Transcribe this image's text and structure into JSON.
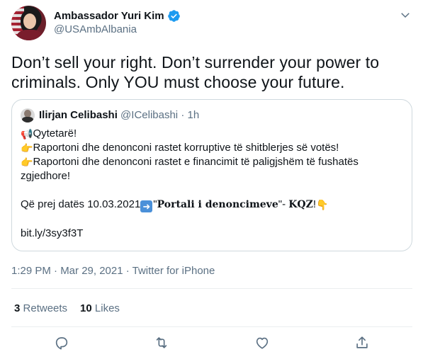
{
  "author": {
    "display_name": "Ambassador Yuri Kim",
    "handle": "@USAmbAlbania"
  },
  "tweet_text": "Don’t sell your right. Don’t surrender your power to criminals. Only YOU must choose your future.",
  "quoted_tweet": {
    "display_name": "Ilirjan Celibashi",
    "handle": "@ICelibashi",
    "separator": "·",
    "time": "1h",
    "lines": {
      "l1": "Qytetarë!",
      "l2": "Raportoni dhe denonconi rastet korruptive të shitblerjes së votës!",
      "l3": "Raportoni dhe denonconi rastet e financimit të paligjshëm të fushatës",
      "l4": "zgjedhore!",
      "l5_prefix": "Që prej datës 10.03.2021",
      "l5_quote_open": "\"",
      "l5_portal": "Portali i denoncimeve",
      "l5_quote_close": "\"",
      "l5_dash": "- ",
      "l5_kqz": "KQZ",
      "l5_excl": "!",
      "link": "bit.ly/3sy3f3T"
    },
    "emojis": {
      "megaphone": "📢",
      "point_right": "👉",
      "arrow_right": "➡",
      "point_down": "👇"
    }
  },
  "meta": "1:29 PM · Mar 29, 2021 · Twitter for iPhone",
  "stats": {
    "retweets_count": "3",
    "retweets_label": "Retweets",
    "likes_count": "10",
    "likes_label": "Likes"
  },
  "icons": {
    "verified": "verified-badge-icon",
    "more": "more-icon",
    "reply": "reply-icon",
    "retweet": "retweet-icon",
    "like": "like-icon",
    "share": "share-icon"
  },
  "colors": {
    "verified_blue": "#1d9bf0",
    "secondary_text": "#5b7083",
    "border": "#cfd9de"
  }
}
